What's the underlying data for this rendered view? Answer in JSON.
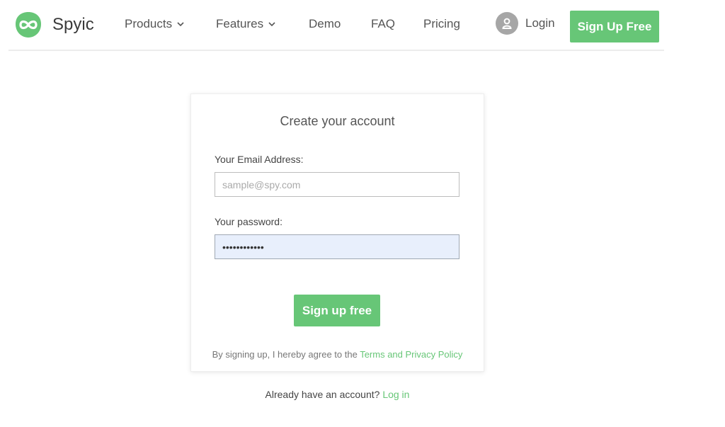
{
  "brand": {
    "name": "Spyic",
    "accent_color": "#67c677",
    "logo_icon": "infinity-icon"
  },
  "nav": {
    "items": [
      {
        "label": "Products",
        "has_dropdown": true
      },
      {
        "label": "Features",
        "has_dropdown": true
      },
      {
        "label": "Demo",
        "has_dropdown": false
      },
      {
        "label": "FAQ",
        "has_dropdown": false
      },
      {
        "label": "Pricing",
        "has_dropdown": false
      }
    ],
    "login_label": "Login",
    "login_icon": "user-icon",
    "signup_label": "Sign Up Free"
  },
  "form": {
    "title": "Create your account",
    "email_label": "Your Email Address:",
    "email_placeholder": "sample@spy.com",
    "email_value": "",
    "password_label": "Your password:",
    "password_value": "............",
    "submit_label": "Sign up free",
    "terms_prefix": "By signing up, I hereby agree to the",
    "terms_link": "Terms and Privacy Policy"
  },
  "footer": {
    "prompt": "Already have an account?",
    "login_link": "Log in"
  }
}
